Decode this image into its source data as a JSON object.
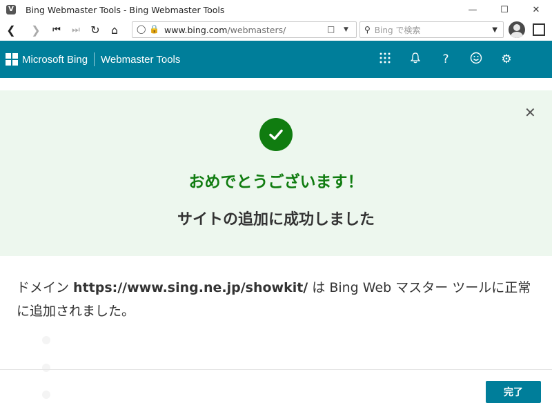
{
  "window": {
    "title": "Bing Webmaster Tools - Bing Webmaster Tools",
    "app_icon": "V",
    "controls": [
      "minimize-icon",
      "maximize-icon",
      "close-icon"
    ]
  },
  "browser": {
    "url_host": "www.bing.com",
    "url_path": "/webmasters/",
    "search_placeholder": "Bing で検索",
    "nav_icons": [
      "back-icon",
      "forward-icon",
      "first-icon",
      "last-icon",
      "reload-icon",
      "home-icon"
    ]
  },
  "header": {
    "brand": "Microsoft Bing",
    "product": "Webmaster Tools",
    "icons": [
      "apps-icon",
      "bell-icon",
      "help-icon",
      "smiley-icon",
      "gear-icon"
    ],
    "bg_color": "#007e9a"
  },
  "banner": {
    "congrats": "おめでとうございます！",
    "subtitle": "サイトの追加に成功しました",
    "bg_color": "#edf7ee",
    "accent_color": "#107c10"
  },
  "message": {
    "prefix": "ドメイン ",
    "domain": "https://www.sing.ne.jp/showkit/",
    "suffix": " は Bing Web マスター ツールに正常に追加されました。"
  },
  "footer": {
    "done_label": "完了"
  }
}
